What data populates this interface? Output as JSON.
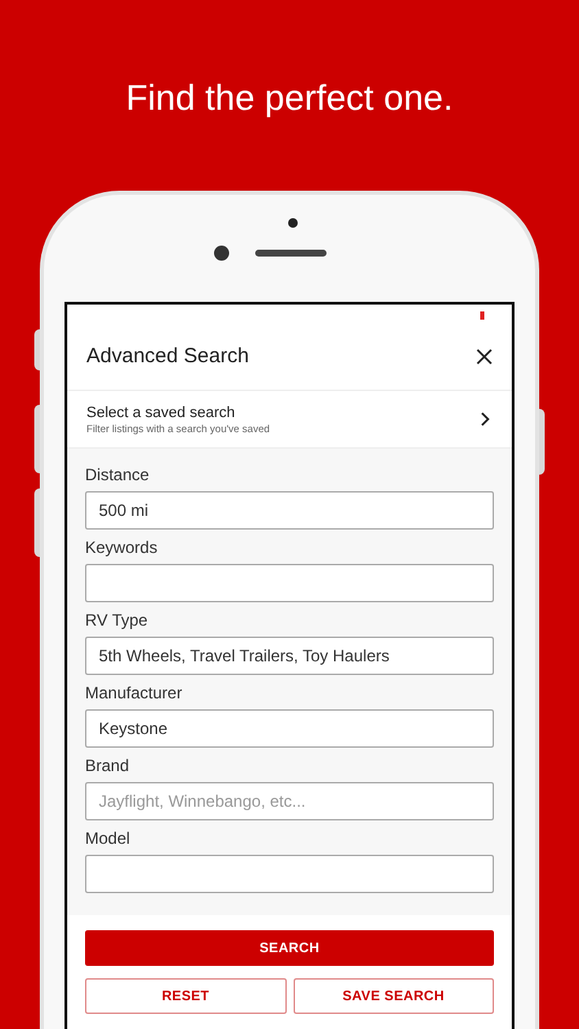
{
  "headline": "Find the perfect one.",
  "header": {
    "title": "Advanced Search"
  },
  "saved_search": {
    "title": "Select a saved search",
    "subtitle": "Filter listings with a search you've saved"
  },
  "fields": [
    {
      "label": "Distance",
      "value": "500 mi"
    },
    {
      "label": "Keywords"
    },
    {
      "label": "RV Type",
      "value": "5th Wheels, Travel Trailers, Toy Haulers"
    },
    {
      "label": "Manufacturer",
      "value": "Keystone"
    },
    {
      "label": "Brand",
      "placeholder": "Jayflight, Winnebango, etc..."
    },
    {
      "label": "Model"
    }
  ],
  "buttons": [
    {
      "label": "SEARCH",
      "kind": "primary"
    },
    {
      "label": "RESET",
      "kind": "outline"
    },
    {
      "label": "SAVE SEARCH",
      "kind": "outline"
    }
  ]
}
